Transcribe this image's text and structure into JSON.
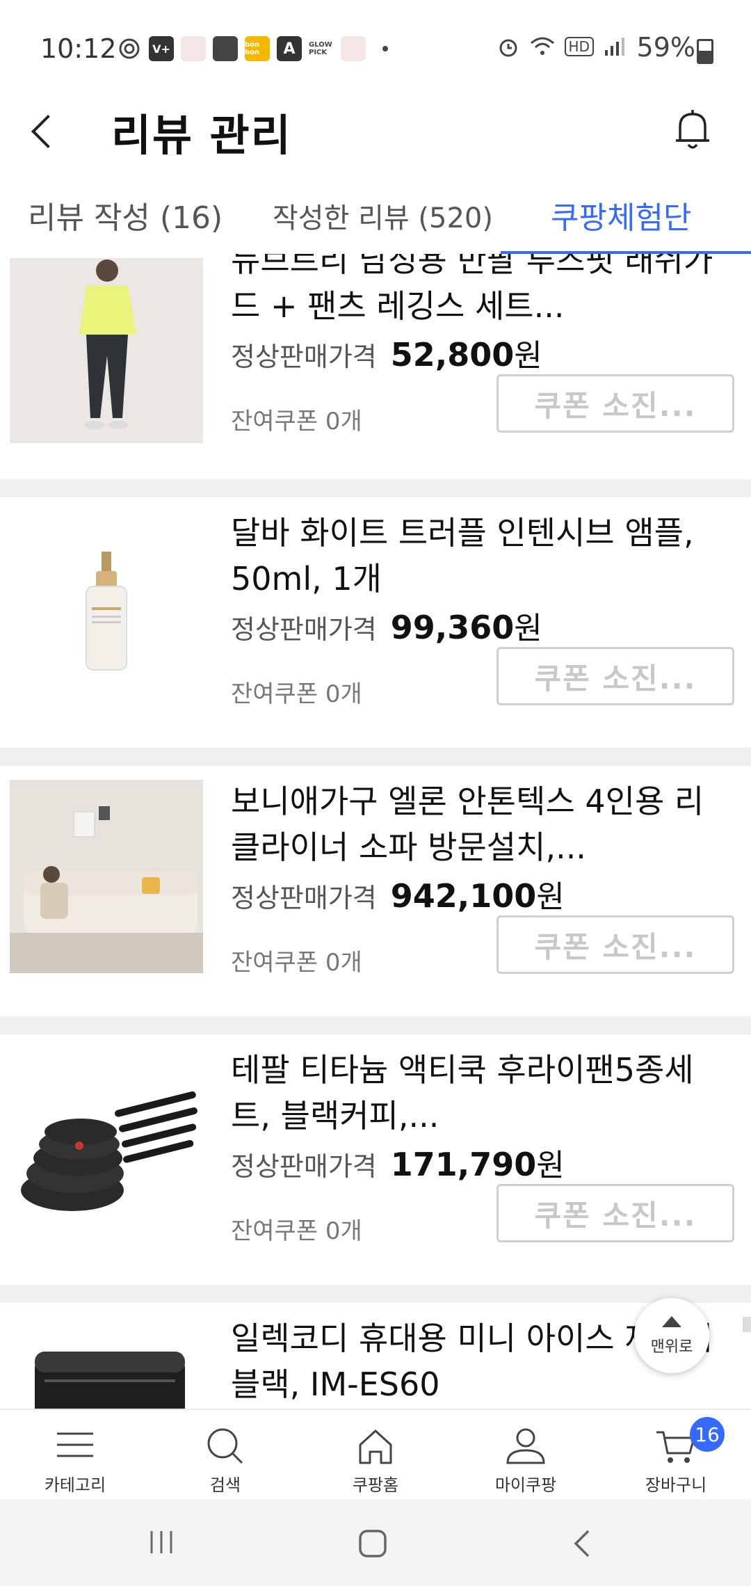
{
  "status_bar": {
    "time": "10:12",
    "battery": "59%",
    "notif_icons": [
      "vplus-icon",
      "app-icon",
      "shopping-bag-icon",
      "bonbon-icon",
      "a-icon",
      "glowpick-icon",
      "app-icon",
      "dot-icon"
    ],
    "bonbon": "bon bon",
    "a": "A",
    "glow": "GLOW PICK",
    "sys": [
      "alarm-icon",
      "wifi-icon",
      "hd-icon",
      "signal-icon"
    ],
    "hd": "HD"
  },
  "header": {
    "title": "리뷰 관리"
  },
  "tabs": [
    {
      "label": "리뷰 작성 (16)",
      "active": false
    },
    {
      "label": "작성한 리뷰 (520)",
      "active": false
    },
    {
      "label": "쿠팡체험단",
      "active": true
    }
  ],
  "items": [
    {
      "name": "뉴브트리 남성용 반팔 루즈핏 래쉬가드 + 팬츠 레깅스 세트...",
      "price_label": "정상판매가격",
      "price": "52,800",
      "currency": "원",
      "remaining": "잔여쿠폰 0개",
      "button": "쿠폰 소진..."
    },
    {
      "name": "달바 화이트 트러플 인텐시브 앰플, 50ml, 1개",
      "price_label": "정상판매가격",
      "price": "99,360",
      "currency": "원",
      "remaining": "잔여쿠폰 0개",
      "button": "쿠폰 소진..."
    },
    {
      "name": "보니애가구 엘론 안톤텍스 4인용 리클라이너 소파 방문설치,...",
      "price_label": "정상판매가격",
      "price": "942,100",
      "currency": "원",
      "remaining": "잔여쿠폰 0개",
      "button": "쿠폰 소진..."
    },
    {
      "name": "테팔 티타늄 액티쿡 후라이팬5종세트, 블랙커피,...",
      "price_label": "정상판매가격",
      "price": "171,790",
      "currency": "원",
      "remaining": "잔여쿠폰 0개",
      "button": "쿠폰 소진..."
    },
    {
      "name": "일렉코디 휴대용 미니 아이스 제빙기 블랙, IM-ES60"
    }
  ],
  "scroll_top": {
    "label": "맨위로"
  },
  "bottom_nav": [
    {
      "label": "카테고리",
      "icon": "menu-icon"
    },
    {
      "label": "검색",
      "icon": "search-icon"
    },
    {
      "label": "쿠팡홈",
      "icon": "home-icon"
    },
    {
      "label": "마이쿠팡",
      "icon": "person-icon"
    },
    {
      "label": "장바구니",
      "icon": "cart-icon",
      "badge": "16"
    }
  ],
  "colors": {
    "accent": "#346aff",
    "disabled_text": "#c8c8c8"
  }
}
